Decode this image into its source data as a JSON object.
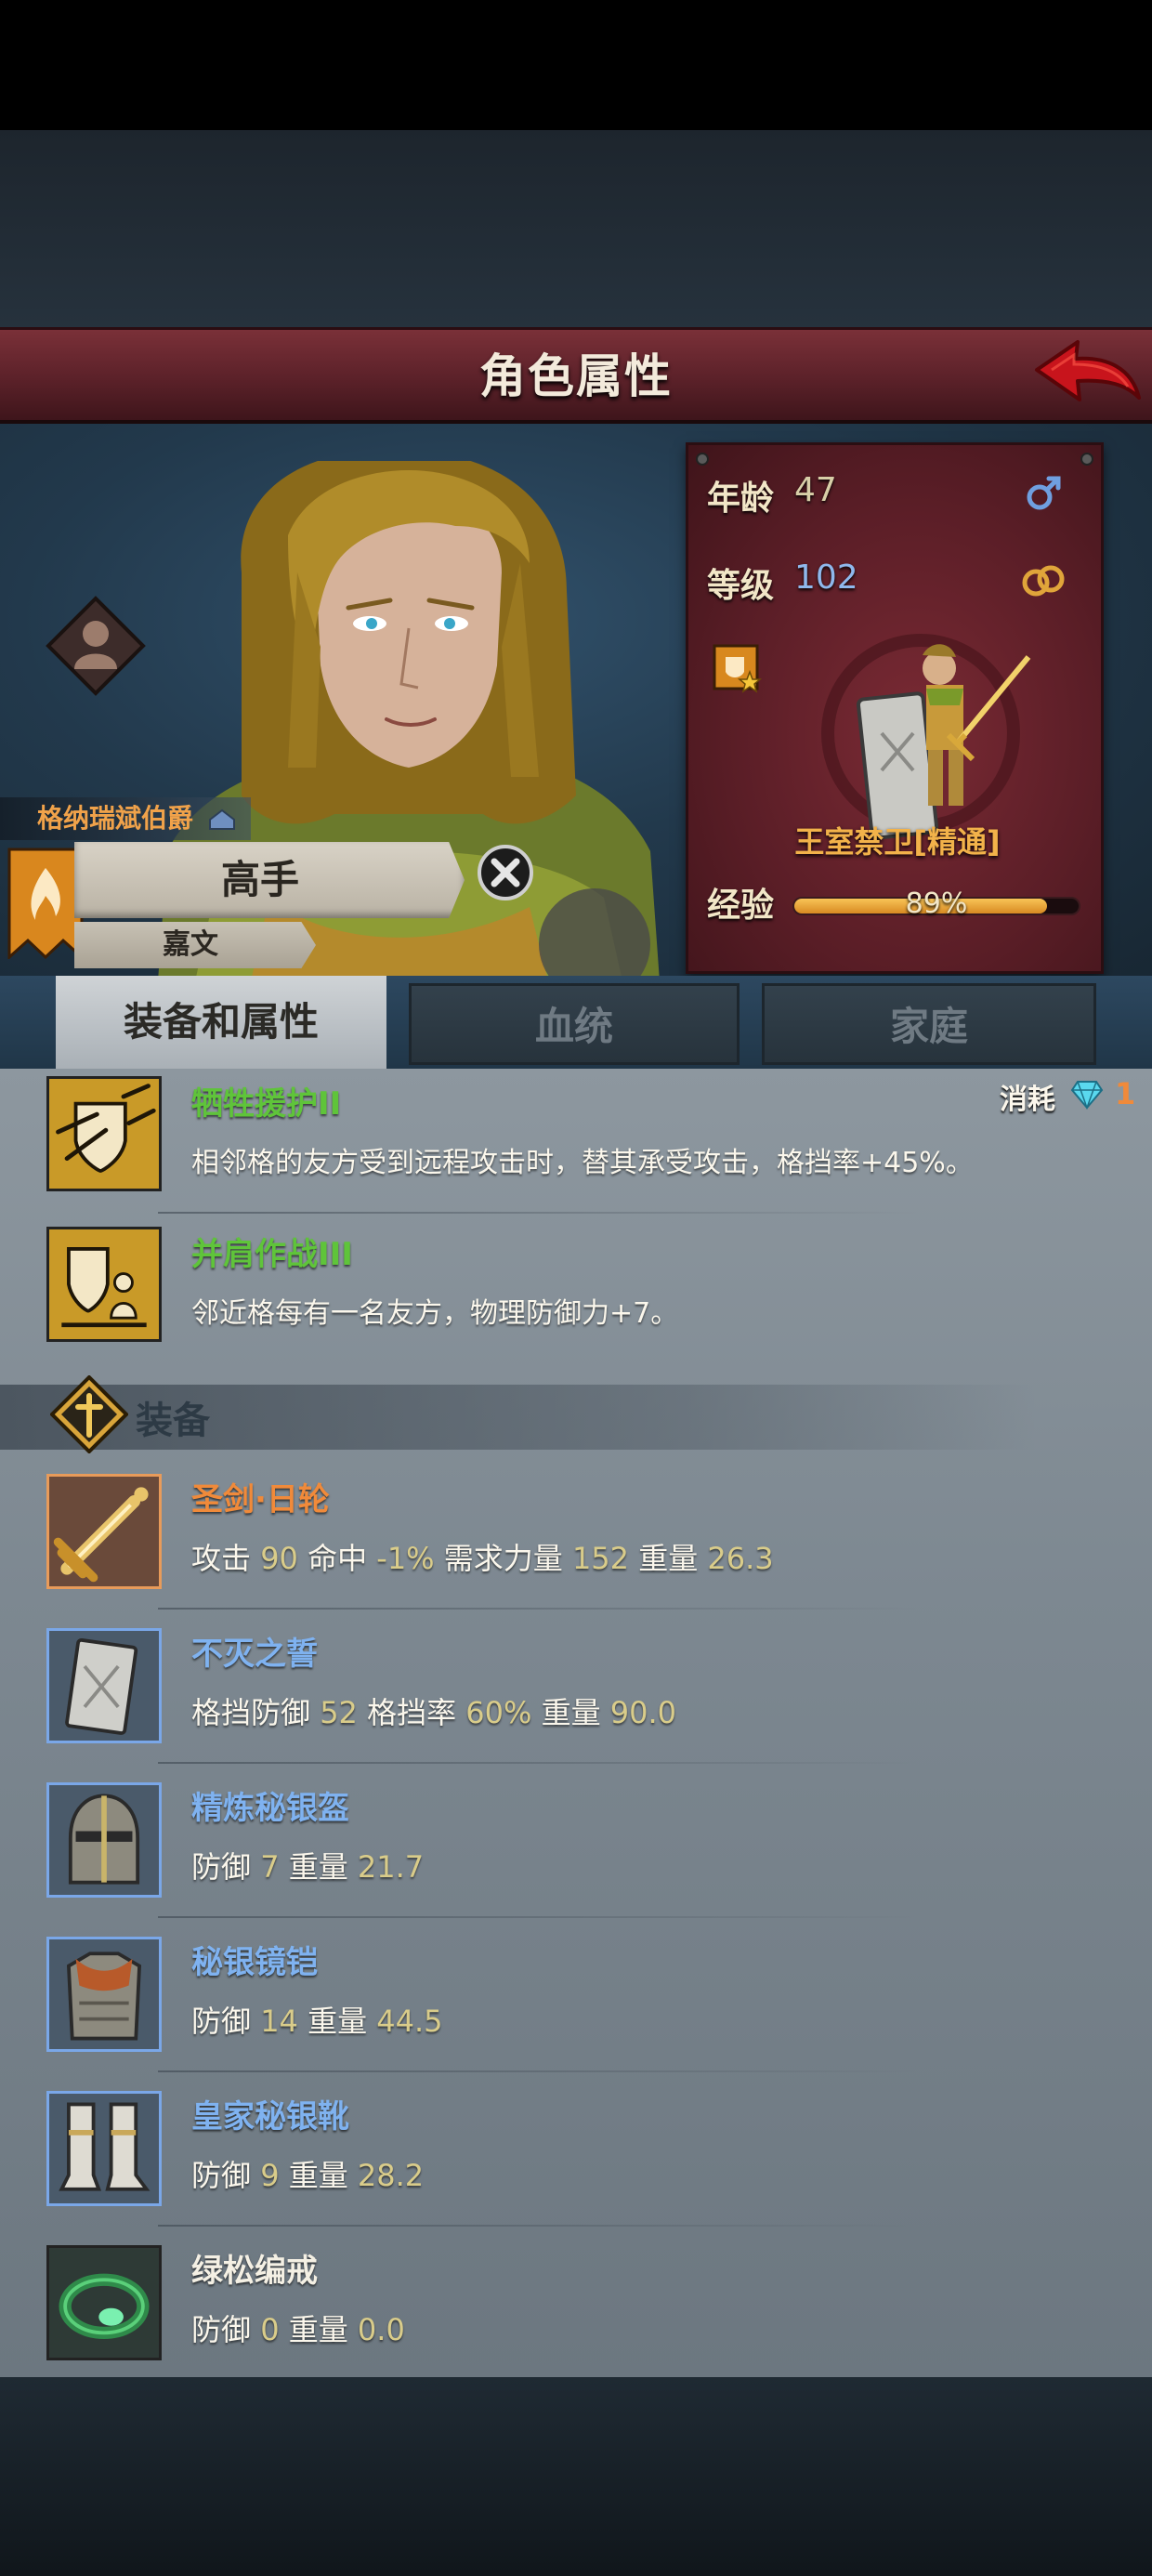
{
  "header": {
    "title": "角色属性"
  },
  "character": {
    "faction": "格纳瑞斌伯爵",
    "title": "高手",
    "name": "嘉文"
  },
  "stats": {
    "age_label": "年龄",
    "age_value": "47",
    "level_label": "等级",
    "level_value": "102",
    "troop_name": "王室禁卫[精通]",
    "exp_label": "经验",
    "exp_percent": "89%",
    "exp_fraction": 0.89
  },
  "tabs": [
    {
      "label": "装备和属性",
      "active": true
    },
    {
      "label": "血统",
      "active": false
    },
    {
      "label": "家庭",
      "active": false
    }
  ],
  "cost": {
    "label": "消耗",
    "value": "1"
  },
  "skills": [
    {
      "name": "牺牲援护II",
      "desc": "相邻格的友方受到远程攻击时，替其承受攻击，格挡率+45%。"
    },
    {
      "name": "并肩作战III",
      "desc": "邻近格每有一名友方，物理防御力+7。"
    }
  ],
  "equipment_section": {
    "title": "装备"
  },
  "equipment": [
    {
      "name": "圣剑·日轮",
      "rarity": "epic",
      "stats": [
        {
          "label": "攻击",
          "value": "90"
        },
        {
          "label": "命中",
          "value": "-1%"
        },
        {
          "label": "需求力量",
          "value": "152"
        },
        {
          "label": "重量",
          "value": "26.3"
        }
      ]
    },
    {
      "name": "不灭之誓",
      "rarity": "rare",
      "stats": [
        {
          "label": "格挡防御",
          "value": "52"
        },
        {
          "label": "格挡率",
          "value": "60%"
        },
        {
          "label": "重量",
          "value": "90.0"
        }
      ]
    },
    {
      "name": "精炼秘银盔",
      "rarity": "rare",
      "stats": [
        {
          "label": "防御",
          "value": "7"
        },
        {
          "label": "重量",
          "value": "21.7"
        }
      ]
    },
    {
      "name": "秘银镜铠",
      "rarity": "rare",
      "stats": [
        {
          "label": "防御",
          "value": "14"
        },
        {
          "label": "重量",
          "value": "44.5"
        }
      ]
    },
    {
      "name": "皇家秘银靴",
      "rarity": "rare",
      "stats": [
        {
          "label": "防御",
          "value": "9"
        },
        {
          "label": "重量",
          "value": "28.2"
        }
      ]
    },
    {
      "name": "绿松编戒",
      "rarity": "common",
      "stats": [
        {
          "label": "防御",
          "value": "0"
        },
        {
          "label": "重量",
          "value": "0.0"
        }
      ]
    }
  ],
  "colors": {
    "skill_name": "#5fc43a",
    "epic_name": "#f08a3a",
    "rare_name": "#7fb2f0",
    "common_name": "#f4f0e4",
    "stat_value": "#d9cc8a",
    "age_value": "#d8cfa8",
    "level_value": "#8fb8ec"
  },
  "icons": {
    "back": "red-back-arrow-icon",
    "gender": "male-symbol-icon",
    "marriage": "rings-icon",
    "dismiss": "close-circle-icon",
    "gem": "diamond-gem-icon"
  }
}
